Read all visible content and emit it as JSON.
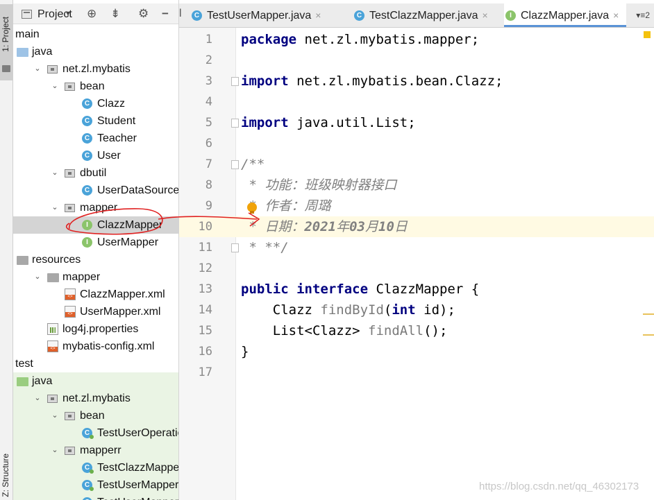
{
  "sidebar": {
    "top_tab_label": "1: Project",
    "bottom_tab_label": "Z: Structure"
  },
  "project_panel": {
    "title": "Project",
    "dropdown_glyph": "▾",
    "icons": [
      "crosshair-icon",
      "collapse-all-icon",
      "gear-icon",
      "minimize-icon"
    ],
    "tree": [
      {
        "label": "main",
        "kind": "none",
        "depth": 0,
        "arrow": "",
        "style": ""
      },
      {
        "label": "java",
        "kind": "folder-blue",
        "depth": 0,
        "arrow": "",
        "style": ""
      },
      {
        "label": "net.zl.mybatis",
        "kind": "package",
        "depth": 1,
        "arrow": "⌄",
        "style": ""
      },
      {
        "label": "bean",
        "kind": "package",
        "depth": 2,
        "arrow": "⌄",
        "style": ""
      },
      {
        "label": "Clazz",
        "kind": "class",
        "depth": 3,
        "arrow": "",
        "style": ""
      },
      {
        "label": "Student",
        "kind": "class",
        "depth": 3,
        "arrow": "",
        "style": ""
      },
      {
        "label": "Teacher",
        "kind": "class",
        "depth": 3,
        "arrow": "",
        "style": ""
      },
      {
        "label": "User",
        "kind": "class",
        "depth": 3,
        "arrow": "",
        "style": ""
      },
      {
        "label": "dbutil",
        "kind": "package",
        "depth": 2,
        "arrow": "⌄",
        "style": ""
      },
      {
        "label": "UserDataSourceFac",
        "kind": "class",
        "depth": 3,
        "arrow": "",
        "style": ""
      },
      {
        "label": "mapper",
        "kind": "package",
        "depth": 2,
        "arrow": "⌄",
        "style": ""
      },
      {
        "label": "ClazzMapper",
        "kind": "iface",
        "depth": 3,
        "arrow": "",
        "style": "selected"
      },
      {
        "label": "UserMapper",
        "kind": "iface",
        "depth": 3,
        "arrow": "",
        "style": ""
      },
      {
        "label": "resources",
        "kind": "folder-gray",
        "depth": 0,
        "arrow": "",
        "style": ""
      },
      {
        "label": "mapper",
        "kind": "folder-gray",
        "depth": 1,
        "arrow": "⌄",
        "style": ""
      },
      {
        "label": "ClazzMapper.xml",
        "kind": "xml",
        "depth": 2,
        "arrow": "",
        "style": ""
      },
      {
        "label": "UserMapper.xml",
        "kind": "xml",
        "depth": 2,
        "arrow": "",
        "style": ""
      },
      {
        "label": "log4j.properties",
        "kind": "props",
        "depth": 1,
        "arrow": "",
        "style": ""
      },
      {
        "label": "mybatis-config.xml",
        "kind": "xml",
        "depth": 1,
        "arrow": "",
        "style": ""
      },
      {
        "label": "test",
        "kind": "none",
        "depth": 0,
        "arrow": "",
        "style": ""
      },
      {
        "label": "java",
        "kind": "folder-green",
        "depth": 0,
        "arrow": "",
        "style": "test"
      },
      {
        "label": "net.zl.mybatis",
        "kind": "package",
        "depth": 1,
        "arrow": "⌄",
        "style": "test"
      },
      {
        "label": "bean",
        "kind": "package",
        "depth": 2,
        "arrow": "⌄",
        "style": "test"
      },
      {
        "label": "TestUserOperation",
        "kind": "testclass",
        "depth": 3,
        "arrow": "",
        "style": "test"
      },
      {
        "label": "mapperr",
        "kind": "package",
        "depth": 2,
        "arrow": "⌄",
        "style": "test"
      },
      {
        "label": "TestClazzMapper",
        "kind": "testclass",
        "depth": 3,
        "arrow": "",
        "style": "test"
      },
      {
        "label": "TestUserMapper",
        "kind": "testclass",
        "depth": 3,
        "arrow": "",
        "style": "test"
      },
      {
        "label": "TestUserMapperN",
        "kind": "testclass",
        "depth": 3,
        "arrow": "",
        "style": "test"
      }
    ]
  },
  "tabs": [
    {
      "label": "TestUserMapper.java",
      "icon": "C",
      "icon_color": "#4aa3d9",
      "active": false
    },
    {
      "label": "TestClazzMapper.java",
      "icon": "C",
      "icon_color": "#4aa3d9",
      "active": false
    },
    {
      "label": "ClazzMapper.java",
      "icon": "I",
      "icon_color": "#8bc46a",
      "active": true
    }
  ],
  "tabs_overflow": "▾≡2",
  "editor": {
    "current_line": 10,
    "lines": [
      {
        "n": "1",
        "tokens": [
          {
            "t": "package ",
            "c": "kw"
          },
          {
            "t": "net.zl.mybatis.mapper;",
            "c": ""
          }
        ]
      },
      {
        "n": "2",
        "tokens": []
      },
      {
        "n": "3",
        "tokens": [
          {
            "t": "import ",
            "c": "kw"
          },
          {
            "t": "net.zl.mybatis.bean.Clazz;",
            "c": ""
          }
        ]
      },
      {
        "n": "4",
        "tokens": []
      },
      {
        "n": "5",
        "tokens": [
          {
            "t": "import ",
            "c": "kw"
          },
          {
            "t": "java.util.List;",
            "c": ""
          }
        ]
      },
      {
        "n": "6",
        "tokens": []
      },
      {
        "n": "7",
        "tokens": [
          {
            "t": "/**",
            "c": "cmt"
          }
        ]
      },
      {
        "n": "8",
        "tokens": [
          {
            "t": " * 功能：班级映射器接口",
            "c": "cmt"
          }
        ]
      },
      {
        "n": "9",
        "tokens": [
          {
            "t": " * 作者：周璐",
            "c": "cmt"
          }
        ]
      },
      {
        "n": "10",
        "tokens": [
          {
            "t": " * 日期：",
            "c": "cmt"
          },
          {
            "t": "2021",
            "c": "cmt-b"
          },
          {
            "t": "年",
            "c": "cmt"
          },
          {
            "t": "03",
            "c": "cmt-b"
          },
          {
            "t": "月",
            "c": "cmt"
          },
          {
            "t": "10",
            "c": "cmt-b"
          },
          {
            "t": "日",
            "c": "cmt"
          }
        ]
      },
      {
        "n": "11",
        "tokens": [
          {
            "t": " * **/",
            "c": "cmt"
          }
        ]
      },
      {
        "n": "12",
        "tokens": []
      },
      {
        "n": "13",
        "tokens": [
          {
            "t": "public ",
            "c": "kw"
          },
          {
            "t": "interface ",
            "c": "kw"
          },
          {
            "t": "ClazzMapper {",
            "c": ""
          }
        ]
      },
      {
        "n": "14",
        "tokens": [
          {
            "t": "    Clazz ",
            "c": ""
          },
          {
            "t": "findById",
            "c": "mth"
          },
          {
            "t": "(",
            "c": ""
          },
          {
            "t": "int ",
            "c": "kw"
          },
          {
            "t": "id);",
            "c": ""
          }
        ]
      },
      {
        "n": "15",
        "tokens": [
          {
            "t": "    List<Clazz> ",
            "c": ""
          },
          {
            "t": "findAll",
            "c": "mth"
          },
          {
            "t": "();",
            "c": ""
          }
        ]
      },
      {
        "n": "16",
        "tokens": [
          {
            "t": "}",
            "c": ""
          }
        ]
      },
      {
        "n": "17",
        "tokens": []
      }
    ]
  },
  "watermark": "https://blog.csdn.net/qq_46302173"
}
